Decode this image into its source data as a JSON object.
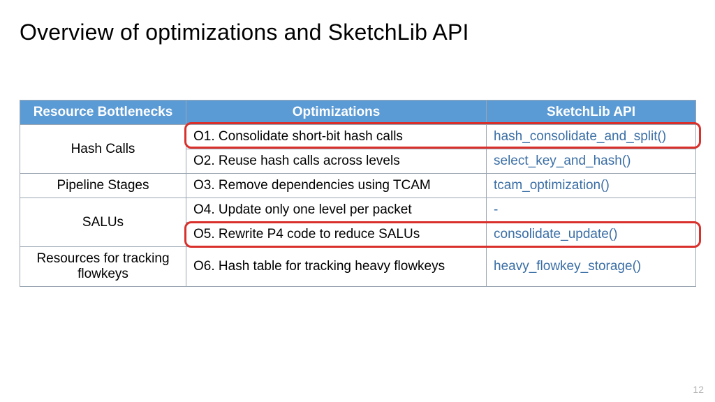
{
  "title": "Overview of optimizations and SketchLib API",
  "page_number": "12",
  "headers": {
    "col1": "Resource Bottlenecks",
    "col2": "Optimizations",
    "col3": "SketchLib API"
  },
  "rows": {
    "r1": {
      "bottleneck": "Hash Calls",
      "opt": "O1. Consolidate short-bit hash calls",
      "api": "hash_consolidate_and_split()"
    },
    "r2": {
      "opt": "O2. Reuse hash calls across levels",
      "api": "select_key_and_hash()"
    },
    "r3": {
      "bottleneck": "Pipeline Stages",
      "opt": "O3. Remove dependencies using TCAM",
      "api": "tcam_optimization()"
    },
    "r4": {
      "bottleneck": "SALUs",
      "opt": "O4. Update only one level per packet",
      "api": "-"
    },
    "r5": {
      "opt": "O5. Rewrite P4 code to reduce SALUs",
      "api": "consolidate_update()"
    },
    "r6": {
      "bottleneck": "Resources for tracking flowkeys",
      "opt": "O6. Hash table for tracking heavy flowkeys",
      "api": "heavy_flowkey_storage()"
    }
  },
  "chart_data": {
    "type": "table",
    "title": "Overview of optimizations and SketchLib API",
    "columns": [
      "Resource Bottlenecks",
      "Optimizations",
      "SketchLib API"
    ],
    "rows": [
      [
        "Hash Calls",
        "O1. Consolidate short-bit hash calls",
        "hash_consolidate_and_split()"
      ],
      [
        "Hash Calls",
        "O2. Reuse hash calls across levels",
        "select_key_and_hash()"
      ],
      [
        "Pipeline Stages",
        "O3. Remove dependencies using TCAM",
        "tcam_optimization()"
      ],
      [
        "SALUs",
        "O4. Update only one level per packet",
        "-"
      ],
      [
        "SALUs",
        "O5. Rewrite P4 code to reduce SALUs",
        "consolidate_update()"
      ],
      [
        "Resources for tracking flowkeys",
        "O6. Hash table for tracking heavy flowkeys",
        "heavy_flowkey_storage()"
      ]
    ],
    "highlighted_rows": [
      0,
      4
    ]
  }
}
